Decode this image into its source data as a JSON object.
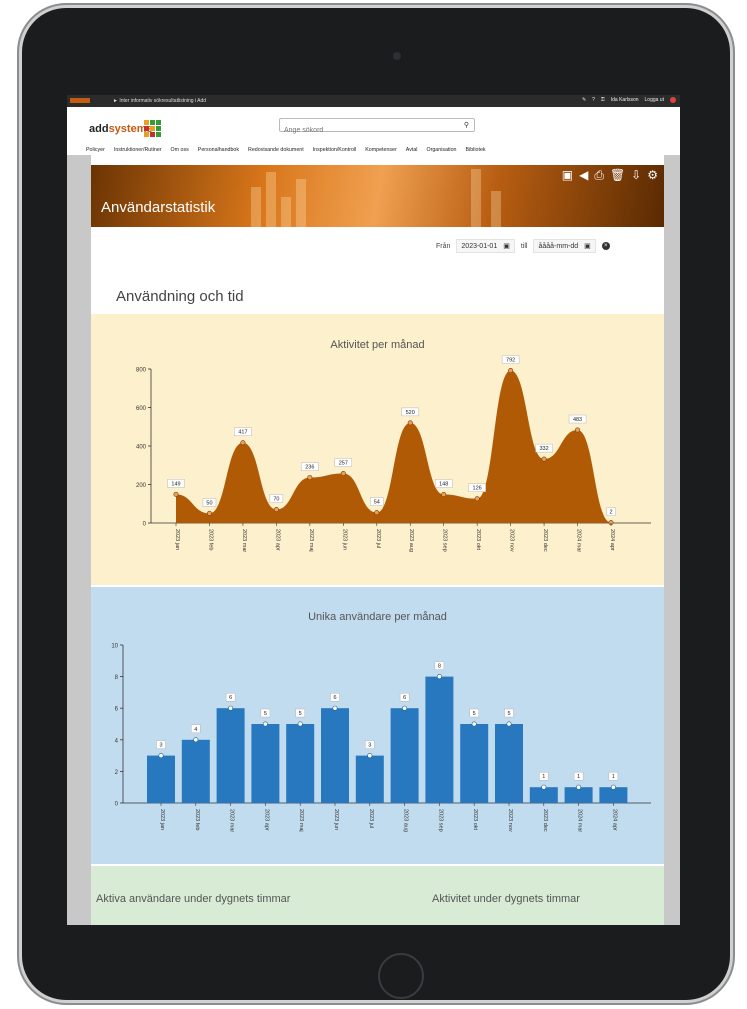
{
  "topbar": {
    "path": "► Inter informativ sökresultatlistning i Add",
    "user": "Ida Karlsson",
    "logout": "Logga ut"
  },
  "brand": {
    "name_prefix": "add",
    "name_suffix": "systems"
  },
  "search": {
    "placeholder": "Ange sökord"
  },
  "nav": [
    "Policyer",
    "Instruktioner/Rutiner",
    "Om oss",
    "Personalhandbok",
    "Redovisande dokument",
    "Inspektion/Kontroll",
    "Kompetenser",
    "Avtal",
    "Organisation",
    "Bibliotek"
  ],
  "page": {
    "title": "Användarstatistik"
  },
  "toolbar_icons": [
    "save-icon",
    "back-icon",
    "print-icon",
    "delete-icon",
    "export-icon",
    "settings-icon"
  ],
  "filter": {
    "from_label": "Från",
    "from_value": "2023-01-01",
    "to_label": "till",
    "to_placeholder": "åååå-mm-dd"
  },
  "section": {
    "title": "Användning och tid"
  },
  "chart_data": [
    {
      "type": "area",
      "title": "Aktivitet per månad",
      "categories": [
        "2023 jan",
        "2023 feb",
        "2023 mar",
        "2023 apr",
        "2023 maj",
        "2023 jun",
        "2023 jul",
        "2023 aug",
        "2023 sep",
        "2023 okt",
        "2023 nov",
        "2023 dec",
        "2024 mar",
        "2024 apr"
      ],
      "values": [
        149,
        50,
        417,
        70,
        236,
        257,
        54,
        520,
        148,
        126,
        792,
        332,
        483,
        2
      ],
      "ylim": [
        0,
        800
      ],
      "yticks": [
        0,
        200,
        400,
        600,
        800
      ],
      "color": "#b05a05",
      "background": "#fdf0cc"
    },
    {
      "type": "bar",
      "title": "Unika användare per månad",
      "categories": [
        "2023 jan",
        "2023 feb",
        "2023 mar",
        "2023 apr",
        "2023 maj",
        "2023 jun",
        "2023 jul",
        "2023 aug",
        "2023 sep",
        "2023 okt",
        "2023 nov",
        "2023 dec",
        "2024 mar",
        "2024 apr"
      ],
      "values": [
        3,
        4,
        6,
        5,
        5,
        6,
        3,
        6,
        8,
        5,
        5,
        1,
        1,
        1
      ],
      "ylim": [
        0,
        10
      ],
      "yticks": [
        0,
        2,
        4,
        6,
        8,
        10
      ],
      "color": "#2878c0",
      "background": "#c2dcef"
    }
  ],
  "green_section": {
    "left_title": "Aktiva användare under dygnets timmar",
    "right_title": "Aktivitet under dygnets timmar"
  }
}
